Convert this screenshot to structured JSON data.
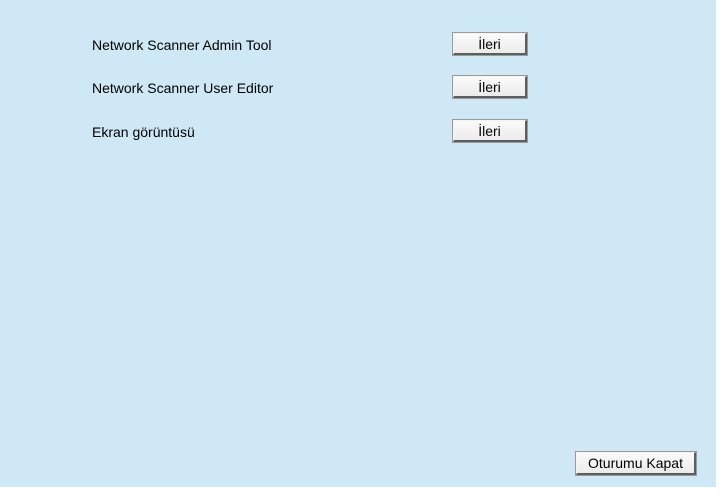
{
  "links": [
    {
      "label": "Network Scanner Admin Tool",
      "button_label": "İleri"
    },
    {
      "label": "Network Scanner User Editor",
      "button_label": "İleri"
    },
    {
      "label": "Ekran görüntüsü",
      "button_label": "İleri"
    }
  ],
  "footer": {
    "logout_label": "Oturumu Kapat"
  },
  "colors": {
    "panel_background": "#cfe8f6",
    "page_background": "#ffffff"
  }
}
